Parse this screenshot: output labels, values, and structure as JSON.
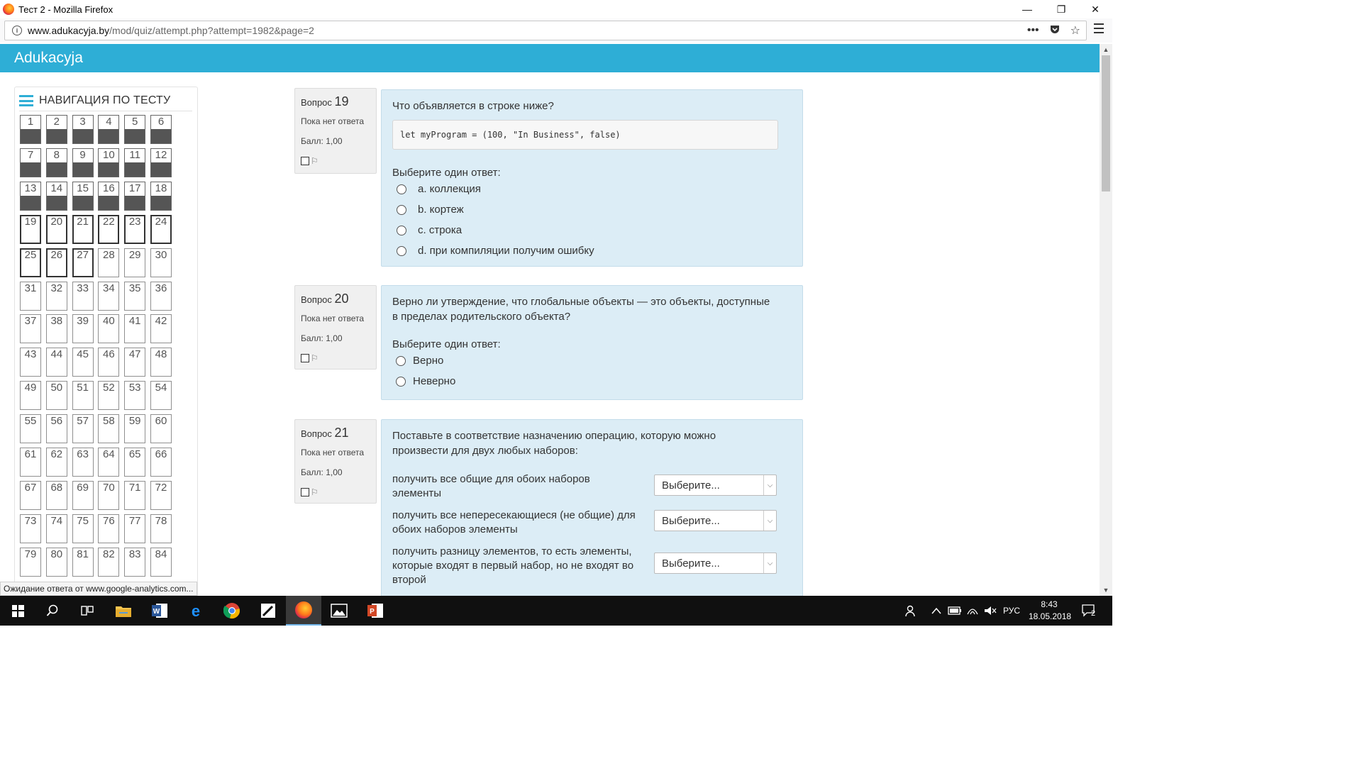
{
  "window": {
    "title": "Тест 2 - Mozilla Firefox",
    "controls": {
      "minimize": "—",
      "restore": "❐",
      "close": "✕"
    }
  },
  "address_bar": {
    "url_host": "www.adukacyja.by",
    "url_path": "/mod/quiz/attempt.php?attempt=1982&page=2"
  },
  "site": {
    "brand": "Adukacyja",
    "accent_color": "#2eaed6"
  },
  "quiz_nav": {
    "title": "НАВИГАЦИЯ ПО ТЕСТУ",
    "total": 84,
    "answered_through": 18,
    "current_page": [
      19,
      20,
      21,
      22,
      23,
      24,
      25,
      26,
      27
    ]
  },
  "questions": [
    {
      "label": "Вопрос",
      "number": "19",
      "state": "Пока нет ответа",
      "grade": "Балл: 1,00",
      "text": "Что объявляется в строке ниже?",
      "code": "let myProgram = (100, \"In Business\", false)",
      "prompt": "Выберите один ответ:",
      "options": [
        "a. коллекция",
        "b. кортеж",
        "c. строка",
        "d. при компиляции получим ошибку"
      ]
    },
    {
      "label": "Вопрос",
      "number": "20",
      "state": "Пока нет ответа",
      "grade": "Балл: 1,00",
      "text_line1": "Верно ли утверждение, что глобальные объекты — это объекты, доступные",
      "text_line2": "в пределах родительского объекта?",
      "prompt": "Выберите один ответ:",
      "options": [
        "Верно",
        "Неверно"
      ]
    },
    {
      "label": "Вопрос",
      "number": "21",
      "state": "Пока нет ответа",
      "grade": "Балл: 1,00",
      "text_line1": "Поставьте в соответствие назначению операцию, которую можно",
      "text_line2": "произвести для двух любых наборов:",
      "rows": [
        {
          "line1": "получить все общие для обоих наборов",
          "line2": "элементы",
          "line3": "",
          "select": "Выберите..."
        },
        {
          "line1": "получить все непересекающиеся (не общие) для",
          "line2": "обоих наборов элементы",
          "line3": "",
          "select": "Выберите..."
        },
        {
          "line1": "получить разницу элементов, то есть элементы,",
          "line2": "которые входят в первый набор, но не входят во",
          "line3": "второй",
          "select": "Выберите..."
        }
      ]
    }
  ],
  "status_bar": {
    "text": "Ожидание ответа от www.google-analytics.com..."
  },
  "taskbar": {
    "language": "РУС",
    "time": "8:43",
    "date": "18.05.2018",
    "notifications": "2"
  }
}
